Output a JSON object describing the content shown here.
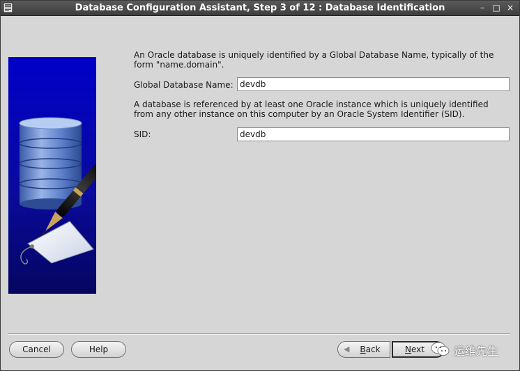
{
  "window": {
    "title": "Database Configuration Assistant, Step 3 of 12 : Database Identification",
    "controls": {
      "minimize": "–",
      "maximize": "□",
      "close": "×"
    }
  },
  "content": {
    "intro_text": "An Oracle database is uniquely identified by a Global Database Name, typically of the form \"name.domain\".",
    "global_db_name": {
      "label": "Global Database Name:",
      "value": "devdb"
    },
    "sid_intro_text": "A database is referenced by at least one Oracle instance which is uniquely identified from any other instance on this computer by an Oracle System Identifier (SID).",
    "sid": {
      "label": "SID:",
      "value": "devdb"
    }
  },
  "footer": {
    "cancel_label": "Cancel",
    "help_label": "Help",
    "back_label": "Back",
    "back_mnemonic": "B",
    "back_rest": "ack",
    "next_label": "Next",
    "next_mnemonic": "N",
    "next_rest": "ext"
  },
  "watermark": {
    "text": "运维先生"
  },
  "colors": {
    "titlebar": "#3e3e3e",
    "illustration_blue": "#0a0a9a",
    "background": "#d6d6d6"
  },
  "icons": {
    "app": "app-window-icon",
    "illustration": "database-pen-illustration",
    "watermark": "wechat-icon"
  }
}
